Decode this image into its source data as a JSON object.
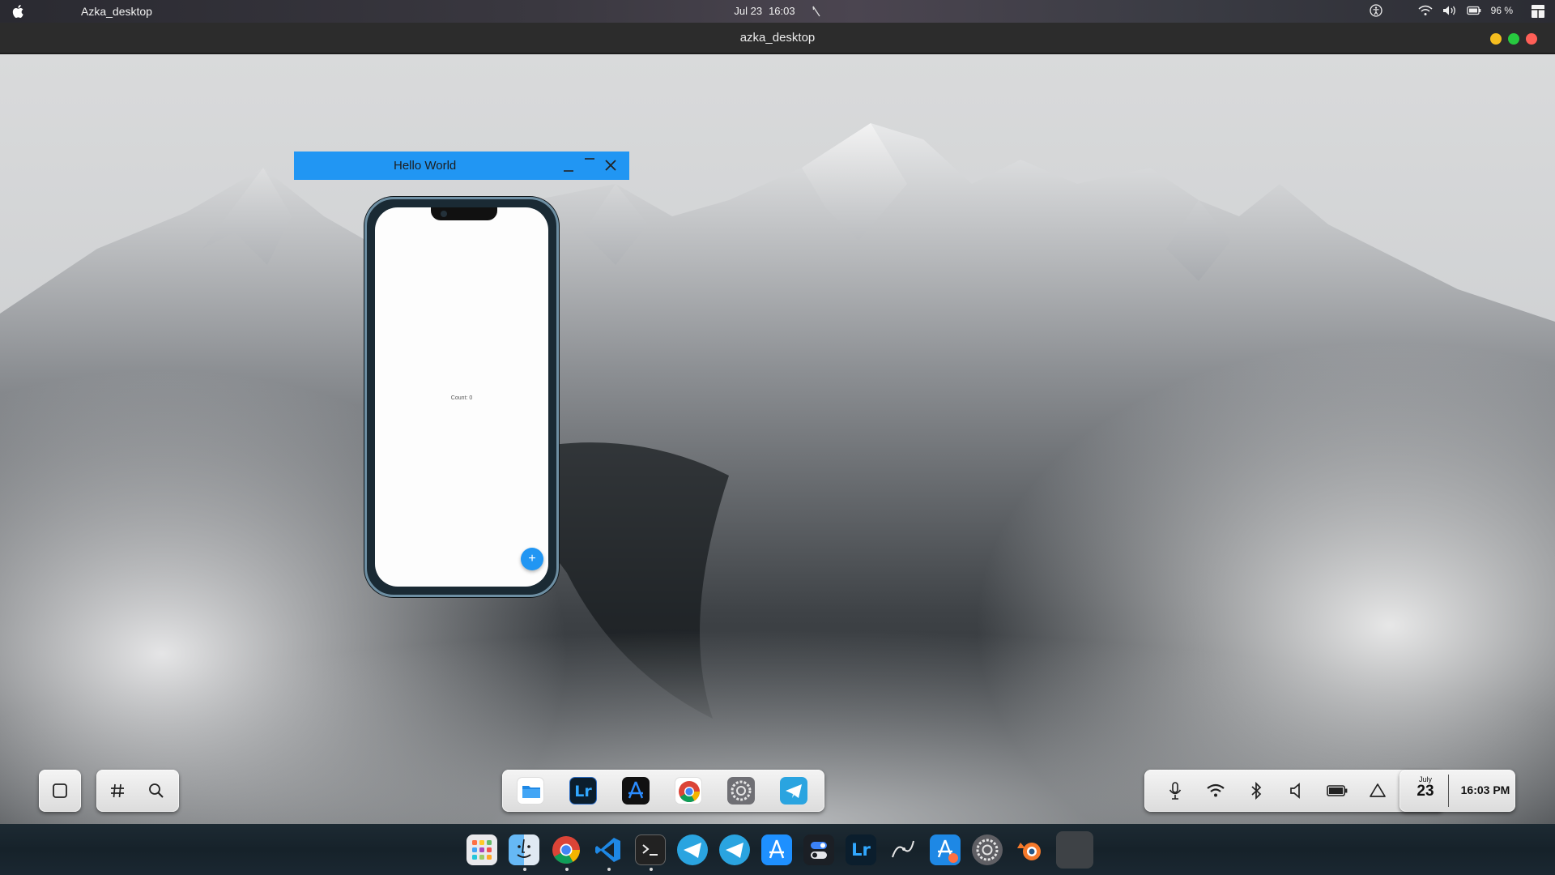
{
  "topbar": {
    "app_name": "Azka_desktop",
    "date": "Jul 23",
    "time": "16:03",
    "battery": "96 %"
  },
  "window": {
    "title": "azka_desktop",
    "controls": [
      "minimize",
      "maximize",
      "close"
    ],
    "control_colors": [
      "#f5bd1f",
      "#27c93f",
      "#ff5f57"
    ]
  },
  "app_window": {
    "title": "Hello World",
    "bar_color": "#2196f3",
    "counter_text": "Count: 0",
    "fab_label": "+"
  },
  "left_dock": {
    "items": [
      "square-icon",
      "hash-icon",
      "search-icon"
    ]
  },
  "center_dock": {
    "apps": [
      {
        "name": "Files",
        "icon": "folder-icon"
      },
      {
        "name": "Lightroom",
        "icon": "lightroom-icon",
        "text": "Lr"
      },
      {
        "name": "App Store",
        "icon": "appstore-icon"
      },
      {
        "name": "Chrome",
        "icon": "chrome-icon"
      },
      {
        "name": "Settings",
        "icon": "settings-icon"
      },
      {
        "name": "Telegram",
        "icon": "telegram-icon"
      }
    ]
  },
  "status_dock": {
    "items": [
      "microphone-icon",
      "wifi-icon",
      "bluetooth-icon",
      "volume-icon",
      "battery-icon",
      "notification-icon"
    ]
  },
  "datetime": {
    "month": "July",
    "day": "23",
    "time": "16:03 PM"
  },
  "bottom_dock": {
    "apps": [
      {
        "name": "Launchpad",
        "icon": "launchpad-icon"
      },
      {
        "name": "Finder",
        "icon": "finder-icon"
      },
      {
        "name": "Chrome",
        "icon": "chrome-icon"
      },
      {
        "name": "VS Code",
        "icon": "vscode-icon"
      },
      {
        "name": "Terminal",
        "icon": "terminal-icon"
      },
      {
        "name": "Telegram",
        "icon": "telegram-icon"
      },
      {
        "name": "Telegram Desktop",
        "icon": "telegram-icon"
      },
      {
        "name": "App Store",
        "icon": "appstore-icon"
      },
      {
        "name": "Toggle",
        "icon": "toggle-icon"
      },
      {
        "name": "Lightroom",
        "icon": "lightroom-icon",
        "text": "Lr"
      },
      {
        "name": "Inkscape",
        "icon": "pen-icon"
      },
      {
        "name": "Software",
        "icon": "software-store-icon"
      },
      {
        "name": "Settings",
        "icon": "settings-icon"
      },
      {
        "name": "Blender",
        "icon": "blender-icon"
      },
      {
        "name": "Active App",
        "icon": "blank-app-icon"
      }
    ]
  }
}
